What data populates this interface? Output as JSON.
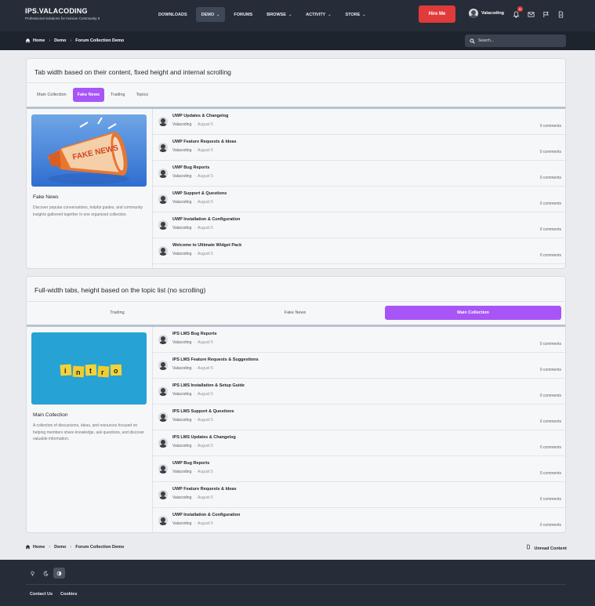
{
  "header": {
    "brand_name": "IPS.VALACODING",
    "brand_tagline": "Professional Solutions for Invision Community 5",
    "nav": [
      {
        "label": "DOWNLOADS",
        "dropdown": false
      },
      {
        "label": "DEMO",
        "dropdown": true,
        "active": true
      },
      {
        "label": "FORUMS",
        "dropdown": false
      },
      {
        "label": "BROWSE",
        "dropdown": true
      },
      {
        "label": "ACTIVITY",
        "dropdown": true
      },
      {
        "label": "STORE",
        "dropdown": true
      }
    ],
    "hire_label": "Hire Me",
    "user_name": "Valacoding",
    "notification_count": "11",
    "icons": [
      "bell-icon",
      "mail-icon",
      "flag-icon",
      "document-icon"
    ]
  },
  "breadcrumb": [
    "Home",
    "Demo",
    "Forum Collection Demo"
  ],
  "search": {
    "placeholder": "Search..."
  },
  "panel1": {
    "title": "Tab width based on their content, fixed height and internal scrolling",
    "tabs": [
      "Main Collection",
      "Fake News",
      "Trading",
      "Topics"
    ],
    "active_tab": 1,
    "collection_name": "Fake News",
    "collection_desc": "Discover popular conversations, helpful guides, and community insights gathered together in one organized collection.",
    "image_text": "FAKE NEWS",
    "topics": [
      {
        "title": "UWP Updates & Changelog",
        "author": "Valacoding",
        "date": "August 5",
        "comments": "0 comments"
      },
      {
        "title": "UWP Feature Requests & Ideas",
        "author": "Valacoding",
        "date": "August 5",
        "comments": "0 comments"
      },
      {
        "title": "UWP Bug Reports",
        "author": "Valacoding",
        "date": "August 5",
        "comments": "0 comments"
      },
      {
        "title": "UWP Support & Questions",
        "author": "Valacoding",
        "date": "August 5",
        "comments": "0 comments"
      },
      {
        "title": "UWP Installation & Configuration",
        "author": "Valacoding",
        "date": "August 5",
        "comments": "0 comments"
      },
      {
        "title": "Welcome to Ultimate Widget Pack",
        "author": "Valacoding",
        "date": "August 5",
        "comments": "0 comments"
      }
    ]
  },
  "panel2": {
    "title": "Full-width tabs, height based on the topic list (no scrolling)",
    "tabs": [
      "Trading",
      "Fake News",
      "Main Collection"
    ],
    "active_tab": 2,
    "collection_name": "Main Collection",
    "collection_desc": "A collection of discussions, ideas, and resources focused on helping members share knowledge, ask questions, and discover valuable information.",
    "image_text": [
      "i",
      "n",
      "t",
      "r",
      "o"
    ],
    "topics": [
      {
        "title": "IPS LMS Bug Reports",
        "author": "Valacoding",
        "date": "August 5",
        "comments": "0 comments"
      },
      {
        "title": "IPS LMS Feature Requests & Suggestions",
        "author": "Valacoding",
        "date": "August 5",
        "comments": "0 comments"
      },
      {
        "title": "IPS LMS Installation & Setup Guide",
        "author": "Valacoding",
        "date": "August 5",
        "comments": "0 comments"
      },
      {
        "title": "IPS LMS Support & Questions",
        "author": "Valacoding",
        "date": "August 5",
        "comments": "0 comments"
      },
      {
        "title": "IPS LMS Updates & Changelog",
        "author": "Valacoding",
        "date": "August 5",
        "comments": "0 comments"
      },
      {
        "title": "UWP Bug Reports",
        "author": "Valacoding",
        "date": "August 5",
        "comments": "0 comments"
      },
      {
        "title": "UWP Feature Requests & Ideas",
        "author": "Valacoding",
        "date": "August 5",
        "comments": "0 comments"
      },
      {
        "title": "UWP Installation & Configuration",
        "author": "Valacoding",
        "date": "August 5",
        "comments": "0 comments"
      }
    ]
  },
  "footer": {
    "unread_label": "Unread Content",
    "links": [
      "Contact Us",
      "Cookies"
    ],
    "theme_icons": [
      "light-theme-icon",
      "dark-theme-icon",
      "auto-theme-icon"
    ]
  },
  "colors": {
    "accent": "#a855f7",
    "header_bg": "#262d38",
    "hire_button": "#e03a3a"
  }
}
